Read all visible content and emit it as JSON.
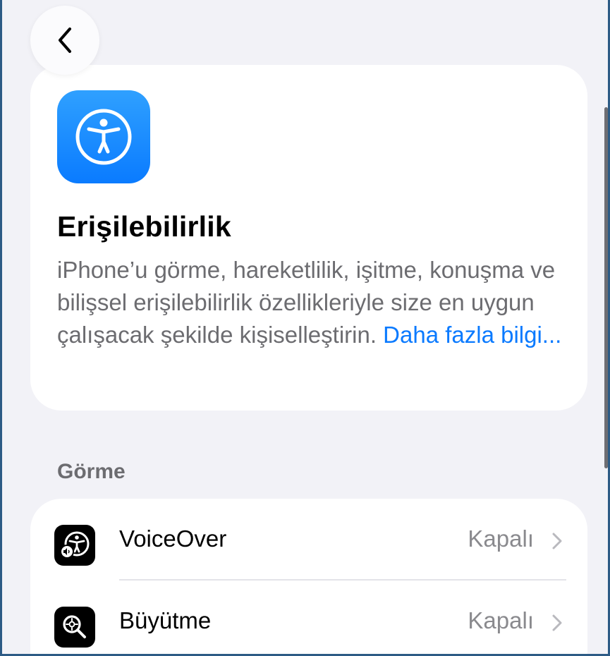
{
  "nav": {
    "back_icon": "chevron-left-icon"
  },
  "header": {
    "icon": "accessibility-icon",
    "title": "Erişilebilirlik",
    "description": "iPhone’u görme, hareketlilik, işitme, konuşma ve bilişsel erişilebilirlik özellikleriyle size en uygun çalışacak şekilde kişiselleştirin.",
    "learn_more": "Daha fazla bilgi..."
  },
  "sections": [
    {
      "title": "Görme",
      "items": [
        {
          "icon": "voiceover-icon",
          "label": "VoiceOver",
          "value": "Kapalı"
        },
        {
          "icon": "zoom-icon",
          "label": "Büyütme",
          "value": "Kapalı"
        }
      ]
    }
  ],
  "colors": {
    "accent": "#0a7aff",
    "background": "#f2f2f7",
    "card": "#ffffff",
    "frame": "#2d5b85"
  }
}
